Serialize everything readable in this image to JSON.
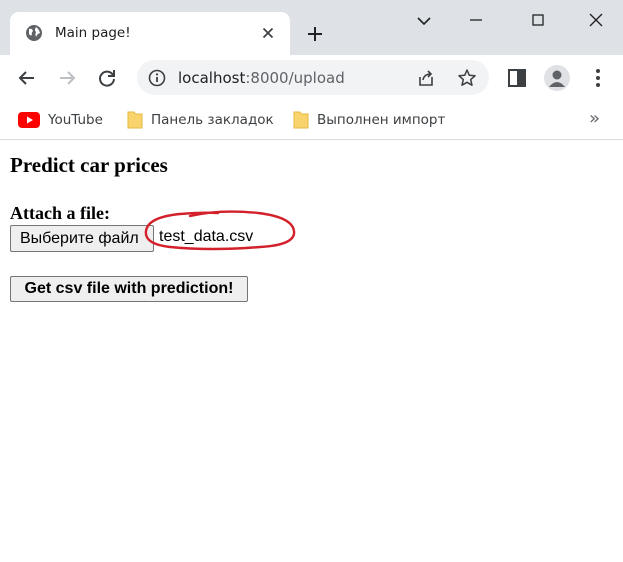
{
  "browser": {
    "tab": {
      "title": "Main page!"
    },
    "address": {
      "host": "localhost",
      "path": ":8000/upload"
    },
    "bookmarks": [
      {
        "label": "YouTube",
        "icon": "youtube-icon"
      },
      {
        "label": "Панель закладок",
        "icon": "folder-icon"
      },
      {
        "label": "Выполнен импорт",
        "icon": "folder-icon"
      }
    ],
    "bookmarks_more": "»"
  },
  "page": {
    "heading": "Predict car prices",
    "attach_label": "Attach a file:",
    "file_button": "Выберите файл",
    "file_name": "test_data.csv",
    "submit_button": "Get csv file with prediction!"
  },
  "colors": {
    "chrome_bg": "#dee1e6",
    "omnibox_bg": "#f1f3f4",
    "annotation": "#d3202a",
    "youtube_red": "#ff0000",
    "folder_yellow": "#f9d36b"
  }
}
